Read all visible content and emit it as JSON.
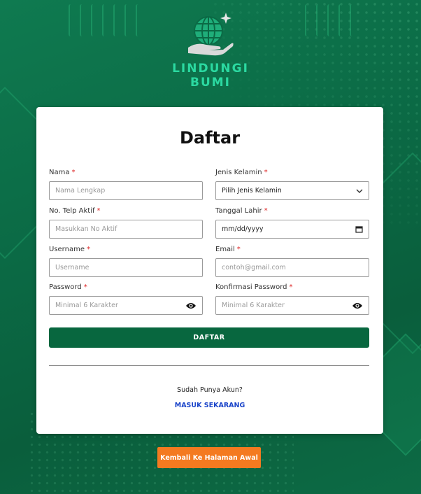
{
  "brand": {
    "name": "LINDUNGI BUMI",
    "logo_icon": "globe-hand-icon"
  },
  "form": {
    "title": "Daftar",
    "required_mark": "*",
    "fields": {
      "nama": {
        "label": "Nama",
        "placeholder": "Nama Lengkap"
      },
      "jenis_kelamin": {
        "label": "Jenis Kelamin",
        "value": "Pilih Jenis Kelamin"
      },
      "telp": {
        "label": "No. Telp Aktif",
        "placeholder": "Masukkan No Aktif"
      },
      "tanggal_lahir": {
        "label": "Tanggal Lahir",
        "value": "mm/dd/yyyy"
      },
      "username": {
        "label": "Username",
        "placeholder": "Username"
      },
      "email": {
        "label": "Email",
        "placeholder": "contoh@gmail.com"
      },
      "password": {
        "label": "Password",
        "placeholder": "Minimal 6 Karakter"
      },
      "konfirmasi": {
        "label": "Konfirmasi Password",
        "placeholder": "Minimal 6 Karakter"
      }
    },
    "submit_label": "DAFTAR",
    "have_account": "Sudah Punya Akun?",
    "login_link": "MASUK SEKARANG"
  },
  "back_button": "Kembali Ke Halaman Awal",
  "colors": {
    "primary": "#08673f",
    "accent": "#f47a20",
    "link": "#1a44c9",
    "brand_text": "#2bd9a1"
  }
}
